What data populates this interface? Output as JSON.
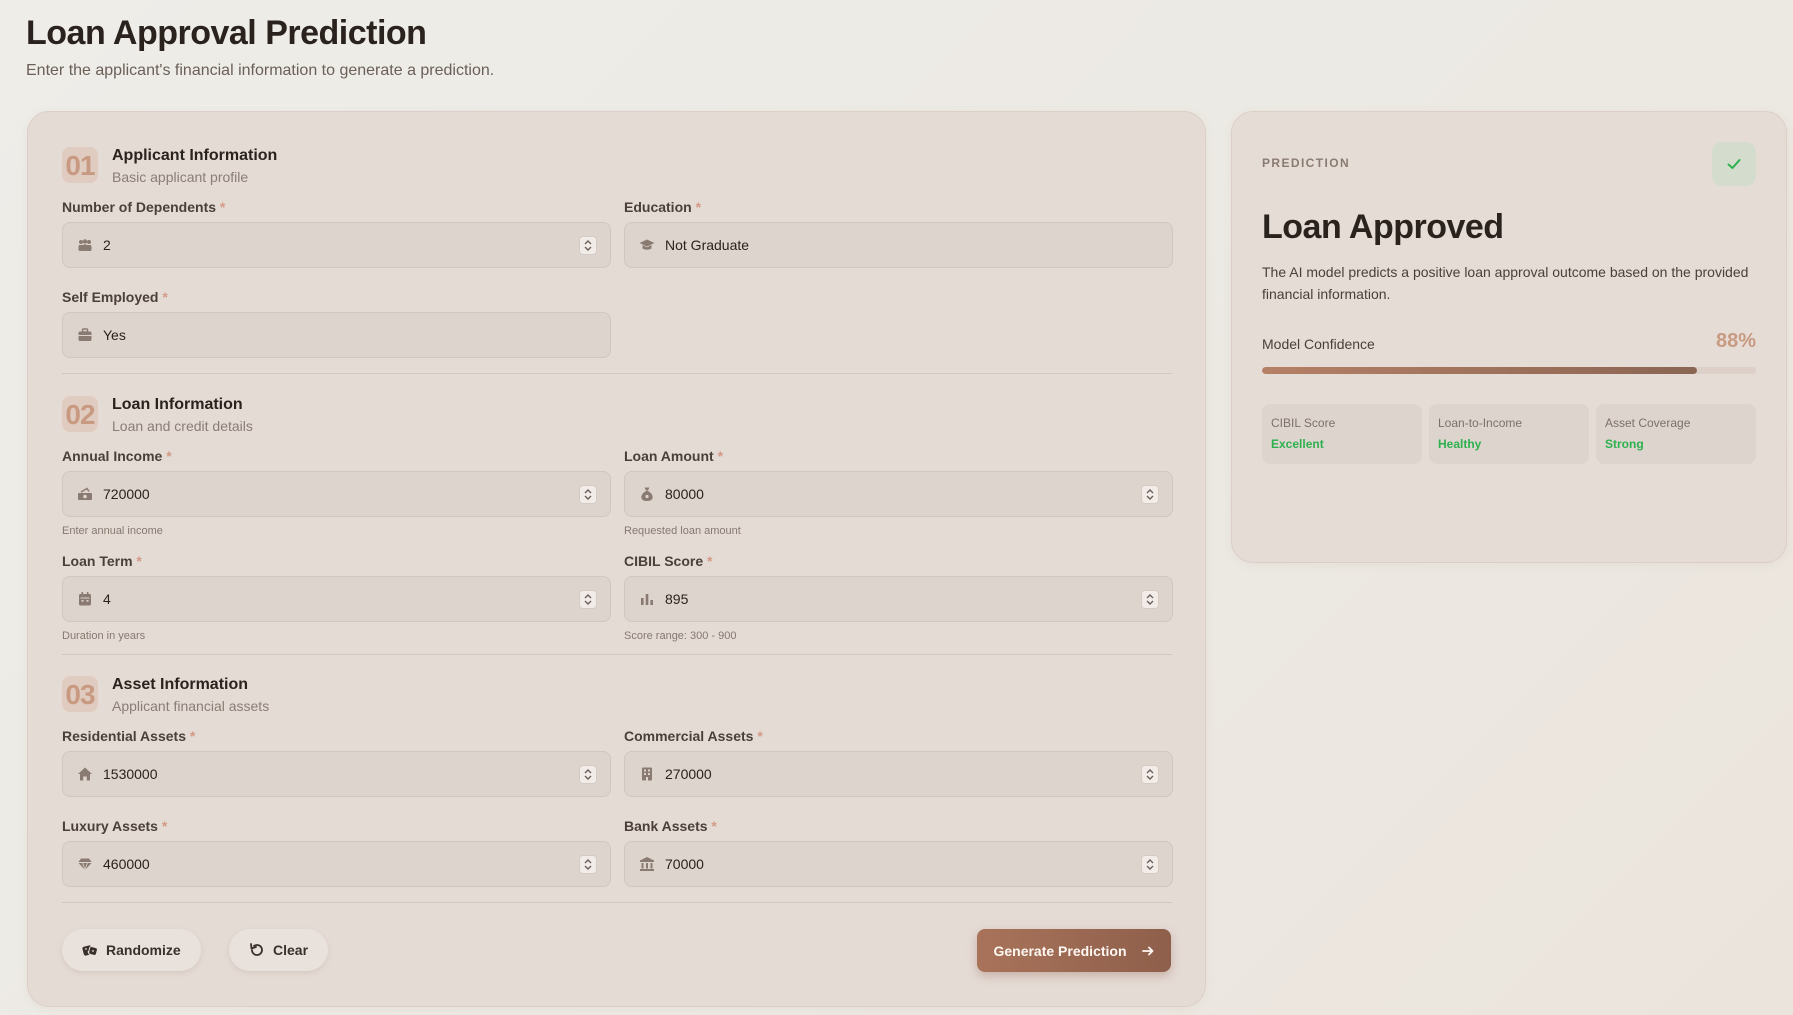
{
  "header": {
    "title": "Loan Approval Prediction",
    "subtitle": "Enter the applicant's financial information to generate a prediction."
  },
  "sections": [
    {
      "number": "01",
      "title": "Applicant Information",
      "description": "Basic applicant profile"
    },
    {
      "number": "02",
      "title": "Loan Information",
      "description": "Loan and credit details"
    },
    {
      "number": "03",
      "title": "Asset Information",
      "description": "Applicant financial assets"
    }
  ],
  "required_marker": "*",
  "fields": {
    "dependents": {
      "label": "Number of Dependents",
      "value": "2",
      "icon": "users-icon"
    },
    "education": {
      "label": "Education",
      "value": "Not Graduate",
      "icon": "graduation-cap-icon"
    },
    "self_employed": {
      "label": "Self Employed",
      "value": "Yes",
      "icon": "briefcase-icon"
    },
    "annual_income": {
      "label": "Annual Income",
      "value": "720000",
      "hint": "Enter annual income",
      "icon": "money-icon"
    },
    "loan_amount": {
      "label": "Loan Amount",
      "value": "80000",
      "hint": "Requested loan amount",
      "icon": "money-bag-icon"
    },
    "loan_term": {
      "label": "Loan Term",
      "value": "4",
      "hint": "Duration in years",
      "icon": "calendar-icon"
    },
    "cibil_score": {
      "label": "CIBIL Score",
      "value": "895",
      "hint": "Score range: 300 - 900",
      "icon": "bar-chart-icon"
    },
    "residential_assets": {
      "label": "Residential Assets",
      "value": "1530000",
      "icon": "house-icon"
    },
    "commercial_assets": {
      "label": "Commercial Assets",
      "value": "270000",
      "icon": "building-icon"
    },
    "luxury_assets": {
      "label": "Luxury Assets",
      "value": "460000",
      "icon": "gem-icon"
    },
    "bank_assets": {
      "label": "Bank Assets",
      "value": "70000",
      "icon": "bank-icon"
    }
  },
  "actions": {
    "randomize_label": "Randomize",
    "clear_label": "Clear",
    "generate_label": "Generate Prediction"
  },
  "prediction": {
    "label": "PREDICTION",
    "title": "Loan Approved",
    "description": "The AI model predicts a positive loan approval outcome based on the provided financial information.",
    "confidence_label": "Model Confidence",
    "confidence_text": "88%",
    "confidence_value": 0.88,
    "metrics": [
      {
        "label": "CIBIL Score",
        "value": "Excellent"
      },
      {
        "label": "Loan-to-Income",
        "value": "Healthy"
      },
      {
        "label": "Asset Coverage",
        "value": "Strong"
      }
    ]
  },
  "colors": {
    "accent": "#a9735a",
    "success": "#2db14f",
    "required": "#d49a86"
  }
}
